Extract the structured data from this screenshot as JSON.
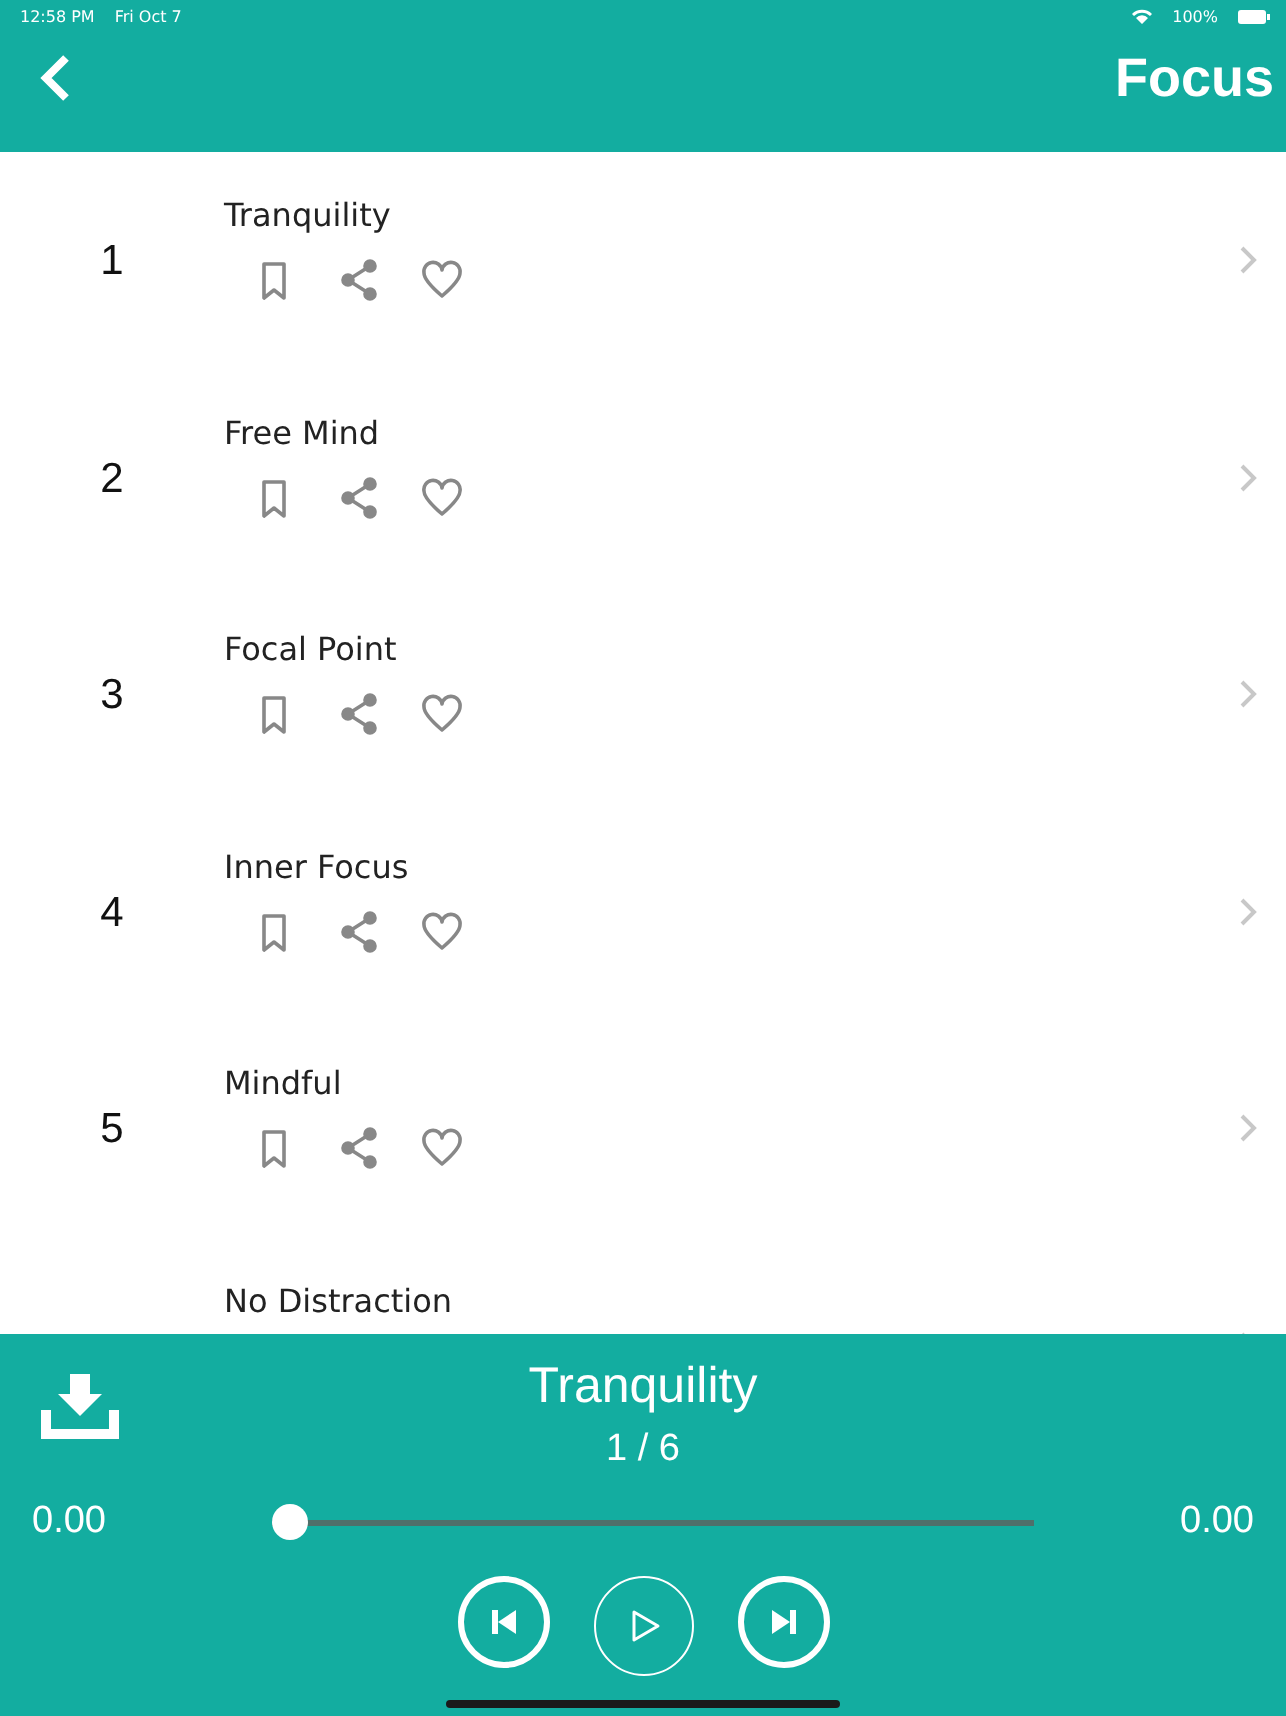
{
  "status_bar": {
    "time": "12:58 PM",
    "date": "Fri Oct 7",
    "battery": "100%"
  },
  "header": {
    "title": "Focus"
  },
  "tracks": [
    {
      "number": "1",
      "title": "Tranquility"
    },
    {
      "number": "2",
      "title": "Free Mind"
    },
    {
      "number": "3",
      "title": "Focal Point"
    },
    {
      "number": "4",
      "title": "Inner Focus"
    },
    {
      "number": "5",
      "title": "Mindful"
    },
    {
      "title": "No Distraction"
    }
  ],
  "player": {
    "title": "Tranquility",
    "position": "1 / 6",
    "elapsed": "0.00",
    "duration": "0.00",
    "level": 0
  }
}
